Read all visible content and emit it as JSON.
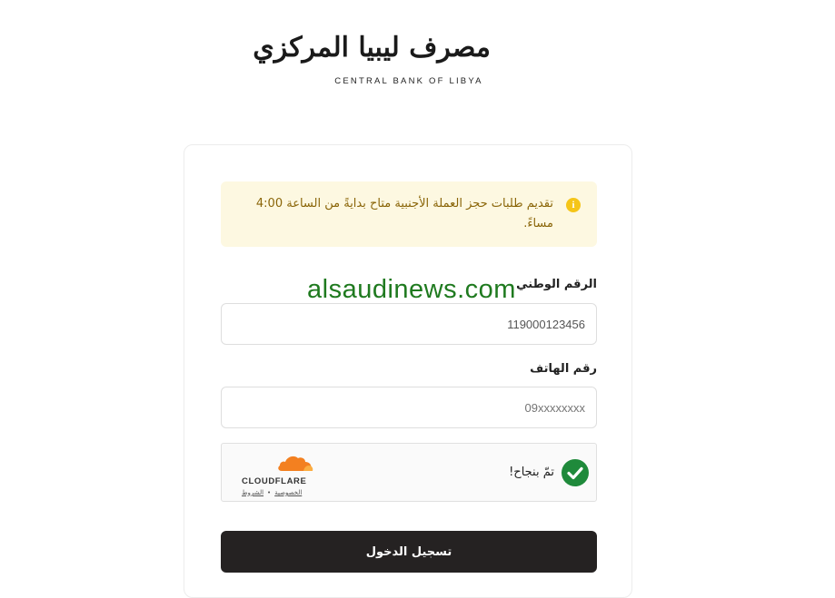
{
  "brand": {
    "name_ar": "مصرف ليبيا المركزي",
    "name_en": "CENTRAL BANK OF LIBYA"
  },
  "alert": {
    "icon": "info-icon",
    "text": "تقديم طلبات حجز العملة الأجنبية متاح بدايةً من الساعة 4:00 مساءً.",
    "color": "#8a6508",
    "background": "#fdf8e1"
  },
  "form": {
    "national_id": {
      "label": "الرقم الوطني",
      "value": "119000123456"
    },
    "phone": {
      "label": "رقم الهاتف",
      "placeholder": "09xxxxxxxx"
    }
  },
  "captcha": {
    "status": "تمّ بنجاح!",
    "provider": "CLOUDFLARE",
    "privacy_link": "الخصوصية",
    "terms_link": "الشروط",
    "check_color": "#1f8a3b",
    "cloud_color": "#f38020"
  },
  "actions": {
    "login_label": "تسجيل الدخول",
    "button_color": "#252222"
  },
  "watermark": {
    "text": "alsaudinews.com",
    "color": "#1f7a1f"
  }
}
